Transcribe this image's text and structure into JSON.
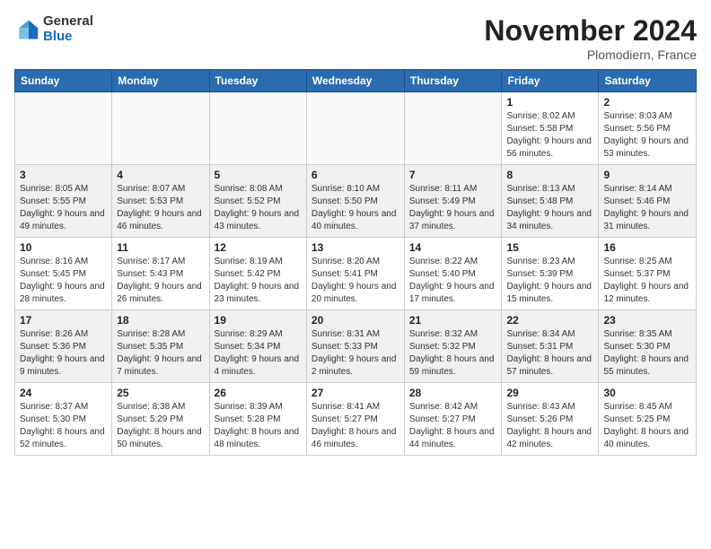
{
  "logo": {
    "general": "General",
    "blue": "Blue"
  },
  "title": "November 2024",
  "location": "Plomodiern, France",
  "days_of_week": [
    "Sunday",
    "Monday",
    "Tuesday",
    "Wednesday",
    "Thursday",
    "Friday",
    "Saturday"
  ],
  "weeks": [
    {
      "shaded": false,
      "days": [
        {
          "num": "",
          "info": ""
        },
        {
          "num": "",
          "info": ""
        },
        {
          "num": "",
          "info": ""
        },
        {
          "num": "",
          "info": ""
        },
        {
          "num": "",
          "info": ""
        },
        {
          "num": "1",
          "info": "Sunrise: 8:02 AM\nSunset: 5:58 PM\nDaylight: 9 hours and 56 minutes."
        },
        {
          "num": "2",
          "info": "Sunrise: 8:03 AM\nSunset: 5:56 PM\nDaylight: 9 hours and 53 minutes."
        }
      ]
    },
    {
      "shaded": true,
      "days": [
        {
          "num": "3",
          "info": "Sunrise: 8:05 AM\nSunset: 5:55 PM\nDaylight: 9 hours and 49 minutes."
        },
        {
          "num": "4",
          "info": "Sunrise: 8:07 AM\nSunset: 5:53 PM\nDaylight: 9 hours and 46 minutes."
        },
        {
          "num": "5",
          "info": "Sunrise: 8:08 AM\nSunset: 5:52 PM\nDaylight: 9 hours and 43 minutes."
        },
        {
          "num": "6",
          "info": "Sunrise: 8:10 AM\nSunset: 5:50 PM\nDaylight: 9 hours and 40 minutes."
        },
        {
          "num": "7",
          "info": "Sunrise: 8:11 AM\nSunset: 5:49 PM\nDaylight: 9 hours and 37 minutes."
        },
        {
          "num": "8",
          "info": "Sunrise: 8:13 AM\nSunset: 5:48 PM\nDaylight: 9 hours and 34 minutes."
        },
        {
          "num": "9",
          "info": "Sunrise: 8:14 AM\nSunset: 5:46 PM\nDaylight: 9 hours and 31 minutes."
        }
      ]
    },
    {
      "shaded": false,
      "days": [
        {
          "num": "10",
          "info": "Sunrise: 8:16 AM\nSunset: 5:45 PM\nDaylight: 9 hours and 28 minutes."
        },
        {
          "num": "11",
          "info": "Sunrise: 8:17 AM\nSunset: 5:43 PM\nDaylight: 9 hours and 26 minutes."
        },
        {
          "num": "12",
          "info": "Sunrise: 8:19 AM\nSunset: 5:42 PM\nDaylight: 9 hours and 23 minutes."
        },
        {
          "num": "13",
          "info": "Sunrise: 8:20 AM\nSunset: 5:41 PM\nDaylight: 9 hours and 20 minutes."
        },
        {
          "num": "14",
          "info": "Sunrise: 8:22 AM\nSunset: 5:40 PM\nDaylight: 9 hours and 17 minutes."
        },
        {
          "num": "15",
          "info": "Sunrise: 8:23 AM\nSunset: 5:39 PM\nDaylight: 9 hours and 15 minutes."
        },
        {
          "num": "16",
          "info": "Sunrise: 8:25 AM\nSunset: 5:37 PM\nDaylight: 9 hours and 12 minutes."
        }
      ]
    },
    {
      "shaded": true,
      "days": [
        {
          "num": "17",
          "info": "Sunrise: 8:26 AM\nSunset: 5:36 PM\nDaylight: 9 hours and 9 minutes."
        },
        {
          "num": "18",
          "info": "Sunrise: 8:28 AM\nSunset: 5:35 PM\nDaylight: 9 hours and 7 minutes."
        },
        {
          "num": "19",
          "info": "Sunrise: 8:29 AM\nSunset: 5:34 PM\nDaylight: 9 hours and 4 minutes."
        },
        {
          "num": "20",
          "info": "Sunrise: 8:31 AM\nSunset: 5:33 PM\nDaylight: 9 hours and 2 minutes."
        },
        {
          "num": "21",
          "info": "Sunrise: 8:32 AM\nSunset: 5:32 PM\nDaylight: 8 hours and 59 minutes."
        },
        {
          "num": "22",
          "info": "Sunrise: 8:34 AM\nSunset: 5:31 PM\nDaylight: 8 hours and 57 minutes."
        },
        {
          "num": "23",
          "info": "Sunrise: 8:35 AM\nSunset: 5:30 PM\nDaylight: 8 hours and 55 minutes."
        }
      ]
    },
    {
      "shaded": false,
      "days": [
        {
          "num": "24",
          "info": "Sunrise: 8:37 AM\nSunset: 5:30 PM\nDaylight: 8 hours and 52 minutes."
        },
        {
          "num": "25",
          "info": "Sunrise: 8:38 AM\nSunset: 5:29 PM\nDaylight: 8 hours and 50 minutes."
        },
        {
          "num": "26",
          "info": "Sunrise: 8:39 AM\nSunset: 5:28 PM\nDaylight: 8 hours and 48 minutes."
        },
        {
          "num": "27",
          "info": "Sunrise: 8:41 AM\nSunset: 5:27 PM\nDaylight: 8 hours and 46 minutes."
        },
        {
          "num": "28",
          "info": "Sunrise: 8:42 AM\nSunset: 5:27 PM\nDaylight: 8 hours and 44 minutes."
        },
        {
          "num": "29",
          "info": "Sunrise: 8:43 AM\nSunset: 5:26 PM\nDaylight: 8 hours and 42 minutes."
        },
        {
          "num": "30",
          "info": "Sunrise: 8:45 AM\nSunset: 5:25 PM\nDaylight: 8 hours and 40 minutes."
        }
      ]
    }
  ]
}
